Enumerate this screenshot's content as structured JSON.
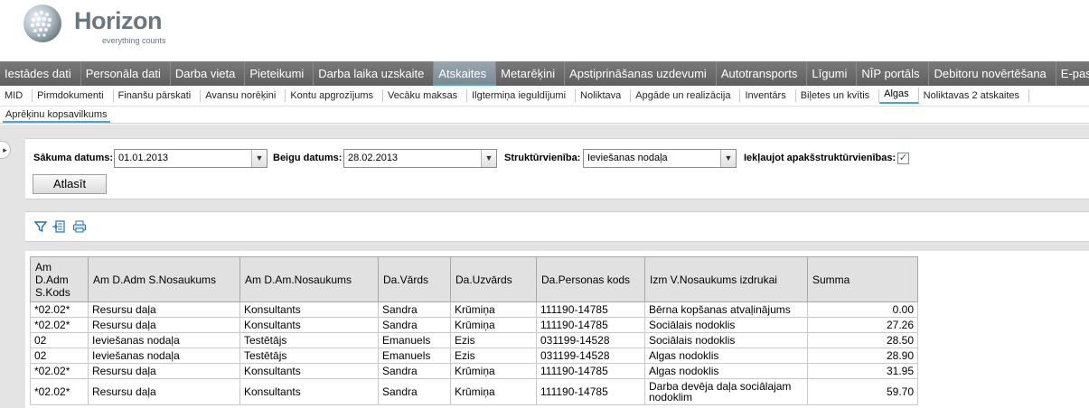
{
  "brand": {
    "name": "Horizon",
    "tagline": "everything counts"
  },
  "main_nav": [
    {
      "label": "Iestādes dati",
      "active": false
    },
    {
      "label": "Personāla dati",
      "active": false
    },
    {
      "label": "Darba vieta",
      "active": false
    },
    {
      "label": "Pieteikumi",
      "active": false
    },
    {
      "label": "Darba laika uzskaite",
      "active": false
    },
    {
      "label": "Atskaites",
      "active": true
    },
    {
      "label": "Metarēķini",
      "active": false
    },
    {
      "label": "Apstiprināšanas uzdevumi",
      "active": false
    },
    {
      "label": "Autotransports",
      "active": false
    },
    {
      "label": "Līgumi",
      "active": false
    },
    {
      "label": "NĪP portāls",
      "active": false
    },
    {
      "label": "Debitoru novērtēšana",
      "active": false
    },
    {
      "label": "E-pasts",
      "active": false
    }
  ],
  "sub_nav": [
    {
      "label": "MID",
      "active": false
    },
    {
      "label": "Pirmdokumenti",
      "active": false
    },
    {
      "label": "Finanšu pārskati",
      "active": false
    },
    {
      "label": "Avansu norēķini",
      "active": false
    },
    {
      "label": "Kontu apgrozījums",
      "active": false
    },
    {
      "label": "Vecāku maksas",
      "active": false
    },
    {
      "label": "Ilgtermiņa ieguldījumi",
      "active": false
    },
    {
      "label": "Noliktava",
      "active": false
    },
    {
      "label": "Apgāde un realizācija",
      "active": false
    },
    {
      "label": "Inventārs",
      "active": false
    },
    {
      "label": "Biļetes un kvītis",
      "active": false
    },
    {
      "label": "Algas",
      "active": true
    },
    {
      "label": "Noliktavas 2 atskaites",
      "active": false
    }
  ],
  "sub_sub_nav": {
    "label": "Aprēķinu kopsavilkums"
  },
  "filters": {
    "start_label": "Sākuma datums:",
    "start_value": "01.01.2013",
    "end_label": "Beigu datums:",
    "end_value": "28.02.2013",
    "unit_label": "Struktūrvienība:",
    "unit_value": "Ieviešanas nodaļa",
    "include_label": "Iekļaujot apakšstruktūrvienības:",
    "include_checked": true,
    "check_mark": "✓",
    "select_button": "Atlasīt"
  },
  "toolbar": {
    "icons": [
      "filter-icon",
      "export-icon",
      "print-icon"
    ]
  },
  "table": {
    "columns": [
      "Am D.Adm S.Kods",
      "Am D.Adm S.Nosaukums",
      "Am D.Am.Nosaukums",
      "Da.Vārds",
      "Da.Uzvārds",
      "Da.Personas kods",
      "Izm V.Nosaukums izdrukai",
      "Summa"
    ],
    "rows": [
      [
        "*02.02*",
        "Resursu daļa",
        "Konsultants",
        "Sandra",
        "Krūmiņa",
        "111190-14785",
        "Bērna kopšanas atvaļinājums",
        "0.00"
      ],
      [
        "*02.02*",
        "Resursu daļa",
        "Konsultants",
        "Sandra",
        "Krūmiņa",
        "111190-14785",
        "Sociālais nodoklis",
        "27.26"
      ],
      [
        "02",
        "Ieviešanas nodaļa",
        "Testētājs",
        "Emanuels",
        "Ezis",
        "031199-14528",
        "Sociālais nodoklis",
        "28.50"
      ],
      [
        "02",
        "Ieviešanas nodaļa",
        "Testētājs",
        "Emanuels",
        "Ezis",
        "031199-14528",
        "Algas nodoklis",
        "28.90"
      ],
      [
        "*02.02*",
        "Resursu daļa",
        "Konsultants",
        "Sandra",
        "Krūmiņa",
        "111190-14785",
        "Algas nodoklis",
        "31.95"
      ],
      [
        "*02.02*",
        "Resursu daļa",
        "Konsultants",
        "Sandra",
        "Krūmiņa",
        "111190-14785",
        "Darba devēja daļa sociālajam nodoklim",
        "59.70"
      ]
    ]
  },
  "colors": {
    "nav_bg": "#6b6b6b",
    "accent": "#4fa3d1",
    "content_bg": "#e4e4e4",
    "header_cell": "#e1e1e1"
  }
}
